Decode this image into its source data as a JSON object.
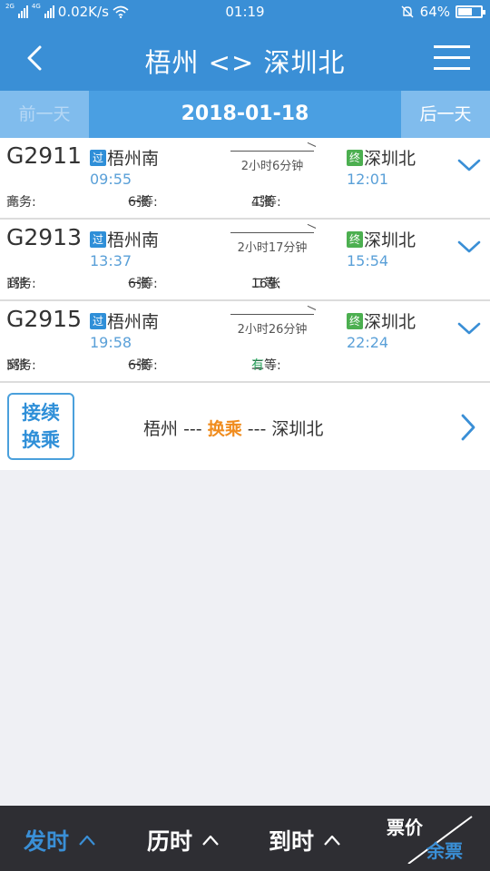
{
  "status_bar": {
    "net_tag_1": "2G",
    "net_tag_2": "4G",
    "speed": "0.02K/s",
    "time": "01:19",
    "battery": "64%",
    "battery_level": 0.64
  },
  "header": {
    "title": "梧州 <> 深圳北"
  },
  "date_bar": {
    "prev_label": "前一天",
    "date": "2018-01-18",
    "next_label": "后一天"
  },
  "badges": {
    "pass": "过",
    "end": "终"
  },
  "trains": [
    {
      "number": "G2911",
      "from": "梧州南",
      "depart": "09:55",
      "duration": "2小时6分钟",
      "to": "深圳北",
      "arrive": "12:01",
      "business_label": "商务:",
      "business": "无",
      "first_label": "一等:",
      "first": "6张",
      "second_label": "二等:",
      "second": "4张"
    },
    {
      "number": "G2913",
      "from": "梧州南",
      "depart": "13:37",
      "duration": "2小时17分钟",
      "to": "深圳北",
      "arrive": "15:54",
      "business_label": "商务:",
      "business": "1张",
      "first_label": "一等:",
      "first": "6张",
      "second_label": "二等:",
      "second": "16张"
    },
    {
      "number": "G2915",
      "from": "梧州南",
      "depart": "19:58",
      "duration": "2小时26分钟",
      "to": "深圳北",
      "arrive": "22:24",
      "business_label": "商务:",
      "business": "5张",
      "first_label": "一等:",
      "first": "6张",
      "second_label": "二等:",
      "second": "有"
    }
  ],
  "transfer": {
    "button_line1": "接续",
    "button_line2": "换乘",
    "from": "梧州",
    "dashes": "---",
    "middle": "换乘",
    "to": "深圳北"
  },
  "bottom_bar": {
    "sort_depart": "发时",
    "sort_duration": "历时",
    "sort_arrive": "到时",
    "price": "票价",
    "remaining": "余票"
  },
  "colors": {
    "primary": "#3a8fd6",
    "accent_orange": "#f08c1e",
    "available_green": "#2ca25f",
    "bottom_bar_bg": "#2e2e33"
  },
  "icons": [
    "back-arrow-icon",
    "menu-icon",
    "chevron-down-icon",
    "chevron-right-icon",
    "sort-up-icon",
    "wifi-icon",
    "notification-off-icon",
    "battery-icon"
  ]
}
